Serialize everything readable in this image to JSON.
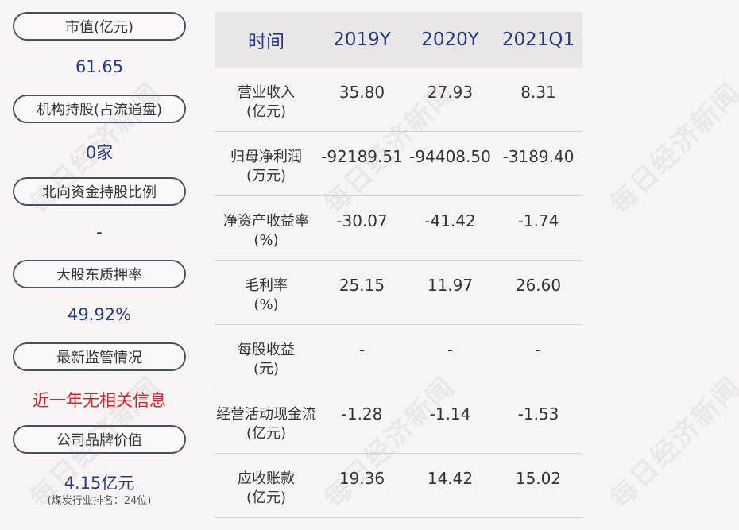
{
  "sidebar": {
    "items": [
      {
        "label": "市值(亿元)",
        "value": "61.65"
      },
      {
        "label": "机构持股(占流通盘)",
        "value": "0家"
      },
      {
        "label": "北向资金持股比例",
        "value": "-"
      },
      {
        "label": "大股东质押率",
        "value": "49.92%"
      },
      {
        "label": "最新监管情况",
        "value": "近一年无相关信息"
      },
      {
        "label": "公司品牌价值",
        "value": "4.15亿元",
        "note": "(煤炭行业排名：24位)"
      }
    ]
  },
  "table": {
    "headers": [
      "时间",
      "2019Y",
      "2020Y",
      "2021Q1"
    ],
    "rows": [
      {
        "name": "营业收入",
        "unit": "(亿元)",
        "values": [
          "35.80",
          "27.93",
          "8.31"
        ]
      },
      {
        "name": "归母净利润",
        "unit": "(万元)",
        "values": [
          "-92189.51",
          "-94408.50",
          "-3189.40"
        ]
      },
      {
        "name": "净资产收益率",
        "unit": "(%)",
        "values": [
          "-30.07",
          "-41.42",
          "-1.74"
        ]
      },
      {
        "name": "毛利率",
        "unit": "(%)",
        "values": [
          "25.15",
          "11.97",
          "26.60"
        ]
      },
      {
        "name": "每股收益",
        "unit": "(元)",
        "values": [
          "-",
          "-",
          "-"
        ]
      },
      {
        "name": "经营活动现金流",
        "unit": "(亿元)",
        "values": [
          "-1.28",
          "-1.14",
          "-1.53"
        ]
      },
      {
        "name": "应收账款",
        "unit": "(亿元)",
        "values": [
          "19.36",
          "14.42",
          "15.02"
        ]
      }
    ]
  },
  "watermark": "每日经济新闻",
  "colors": {
    "accent": "#273a7c",
    "alert": "#d9222a",
    "background": "#f8f4f5"
  }
}
